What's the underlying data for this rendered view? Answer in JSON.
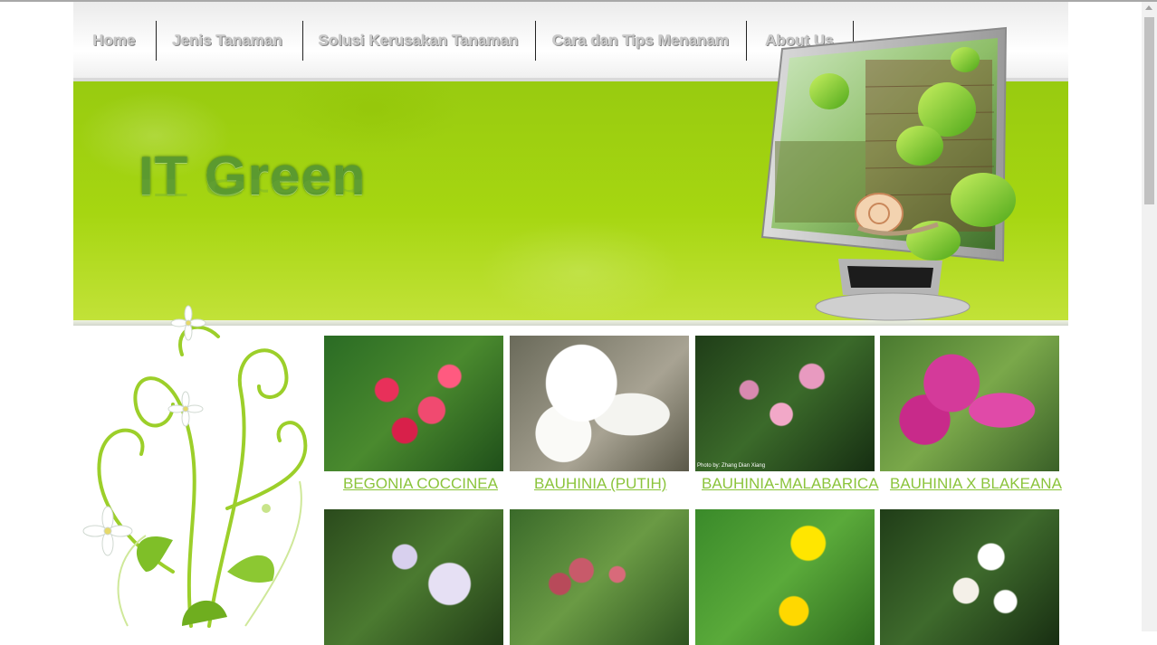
{
  "nav": {
    "items": [
      {
        "label": "Home"
      },
      {
        "label": "Jenis Tanaman"
      },
      {
        "label": "Solusi Kerusakan Tanaman"
      },
      {
        "label": "Cara dan Tips Menanam"
      },
      {
        "label": "About Us"
      }
    ]
  },
  "banner": {
    "logo_text": "IT Green"
  },
  "gallery": {
    "rows": [
      [
        {
          "name": "BEGONIA COCCINEA",
          "photo_icon": "pink-flower-cluster-photo"
        },
        {
          "name": "BAUHINIA (PUTIH)",
          "photo_icon": "white-flower-photo"
        },
        {
          "name": "BAUHINIA-MALABARICA",
          "photo_icon": "pink-orchid-tree-photo",
          "photo_credit": "Photo by: Zhang Dian Xiang"
        },
        {
          "name": "BAUHINIA X BLAKEANA",
          "photo_icon": "magenta-flower-photo"
        }
      ],
      [
        {
          "photo_icon": "lilac-flower-photo"
        },
        {
          "photo_icon": "berry-cluster-photo"
        },
        {
          "photo_icon": "yellow-flower-photo"
        },
        {
          "photo_icon": "white-blossom-photo"
        }
      ]
    ]
  },
  "colors": {
    "accent_green": "#8bc43b",
    "banner_green": "#a6d611",
    "logo_green": "#5b9a2f"
  }
}
